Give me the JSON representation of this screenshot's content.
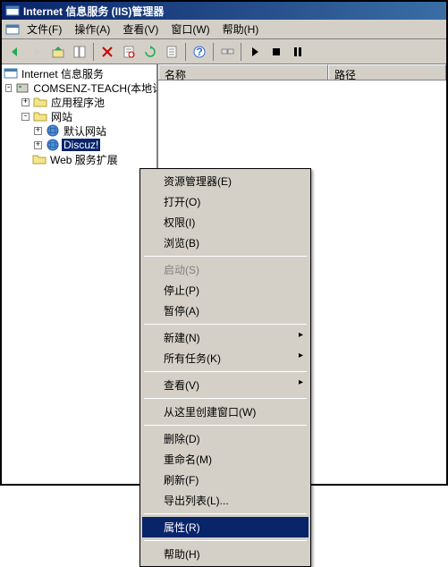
{
  "titlebar": {
    "title": "Internet 信息服务 (IIS)管理器"
  },
  "menubar": {
    "file": "文件(F)",
    "action": "操作(A)",
    "view": "查看(V)",
    "window": "窗口(W)",
    "help": "帮助(H)"
  },
  "tree": {
    "root": "Internet 信息服务",
    "server": "COMSENZ-TEACH(本地计算",
    "apppool": "应用程序池",
    "websites": "网站",
    "default_site": "默认网站",
    "discuz": "Discuz!",
    "webext": "Web 服务扩展"
  },
  "list_headers": {
    "name": "名称",
    "path": "路径"
  },
  "context_menu": {
    "explorer": "资源管理器(E)",
    "open": "打开(O)",
    "permissions": "权限(I)",
    "browse": "浏览(B)",
    "start": "启动(S)",
    "stop": "停止(P)",
    "pause": "暂停(A)",
    "new": "新建(N)",
    "all_tasks": "所有任务(K)",
    "view": "查看(V)",
    "new_window": "从这里创建窗口(W)",
    "delete": "删除(D)",
    "rename": "重命名(M)",
    "refresh": "刷新(F)",
    "export_list": "导出列表(L)...",
    "properties": "属性(R)",
    "help": "帮助(H)"
  }
}
